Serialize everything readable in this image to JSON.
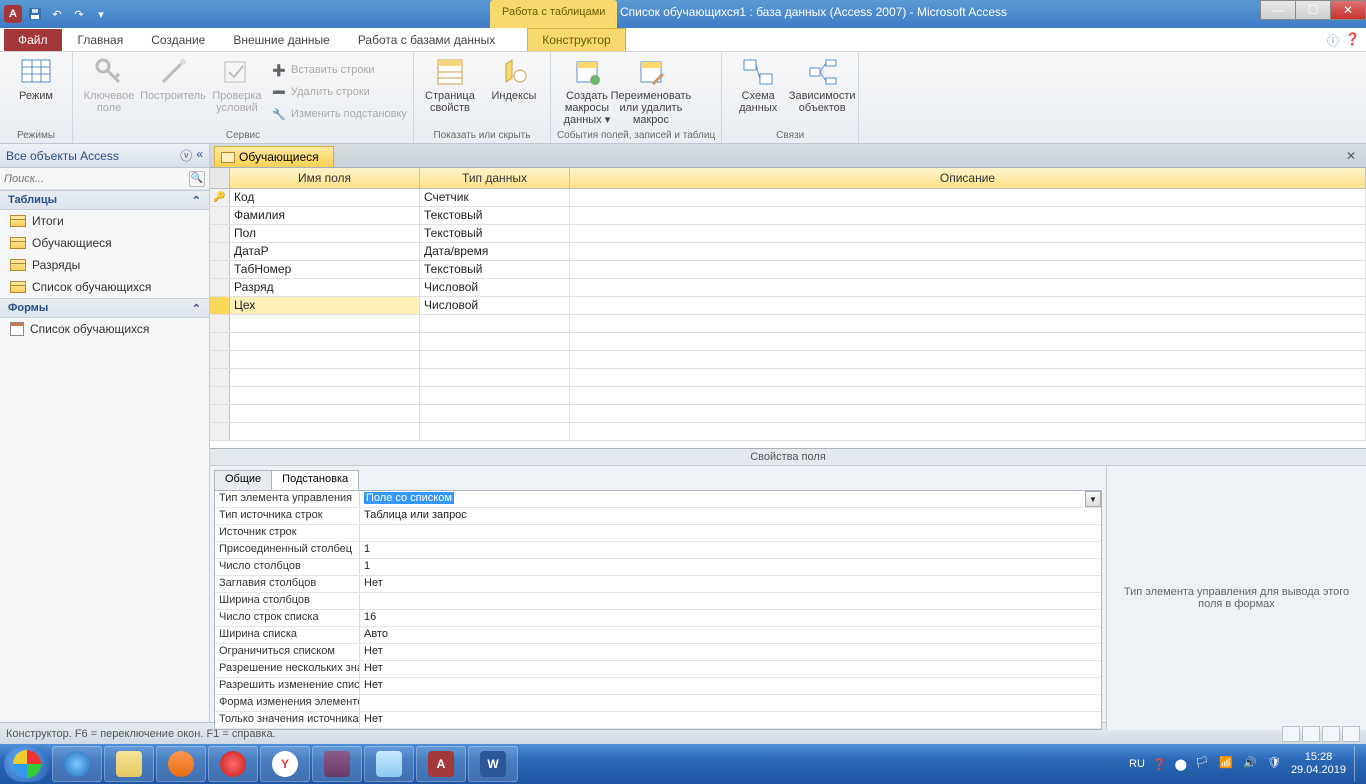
{
  "titlebar": {
    "contextual_tab": "Работа с таблицами",
    "title": "Список обучающихся1 : база данных (Access 2007)  -  Microsoft Access"
  },
  "ribbon_tabs": {
    "file": "Файл",
    "tabs": [
      "Главная",
      "Создание",
      "Внешние данные",
      "Работа с базами данных"
    ],
    "active": "Конструктор"
  },
  "ribbon": {
    "g1": {
      "label": "Режимы",
      "mode": "Режим"
    },
    "g2": {
      "label": "Сервис",
      "key": "Ключевое\nполе",
      "builder": "Построитель",
      "test": "Проверка\nусловий",
      "insert_rows": "Вставить строки",
      "delete_rows": "Удалить строки",
      "modify_lookup": "Изменить подстановку"
    },
    "g3": {
      "label": "Показать или скрыть",
      "propsheet": "Страница\nсвойств",
      "indexes": "Индексы"
    },
    "g4": {
      "label": "События полей, записей и таблиц",
      "create_macros": "Создать макросы\nданных ▾",
      "rename_delete": "Переименовать\nили удалить макрос"
    },
    "g5": {
      "label": "Связи",
      "relationships": "Схема\nданных",
      "dependencies": "Зависимости\nобъектов"
    }
  },
  "navpane": {
    "header": "Все объекты Access",
    "search_placeholder": "Поиск...",
    "groups": {
      "tables": {
        "label": "Таблицы",
        "items": [
          "Итоги",
          "Обучающиеся",
          "Разряды",
          "Список обучающихся"
        ]
      },
      "forms": {
        "label": "Формы",
        "items": [
          "Список обучающихся"
        ]
      }
    }
  },
  "document": {
    "tab": "Обучающиеся",
    "columns": {
      "name": "Имя поля",
      "type": "Тип данных",
      "desc": "Описание"
    },
    "fields": [
      {
        "name": "Код",
        "type": "Счетчик",
        "pk": true
      },
      {
        "name": "Фамилия",
        "type": "Текстовый"
      },
      {
        "name": "Пол",
        "type": "Текстовый"
      },
      {
        "name": "ДатаР",
        "type": "Дата/время"
      },
      {
        "name": "ТабНомер",
        "type": "Текстовый"
      },
      {
        "name": "Разряд",
        "type": "Числовой"
      },
      {
        "name": "Цех",
        "type": "Числовой",
        "selected": true
      }
    ]
  },
  "field_props": {
    "title": "Свойства поля",
    "tabs": {
      "general": "Общие",
      "lookup": "Подстановка"
    },
    "active_tab": "lookup",
    "rows": [
      {
        "label": "Тип элемента управления",
        "value": "Поле со списком",
        "active": true,
        "dropdown": true
      },
      {
        "label": "Тип источника строк",
        "value": "Таблица или запрос"
      },
      {
        "label": "Источник строк",
        "value": ""
      },
      {
        "label": "Присоединенный столбец",
        "value": "1"
      },
      {
        "label": "Число столбцов",
        "value": "1"
      },
      {
        "label": "Заглавия столбцов",
        "value": "Нет"
      },
      {
        "label": "Ширина столбцов",
        "value": ""
      },
      {
        "label": "Число строк списка",
        "value": "16"
      },
      {
        "label": "Ширина списка",
        "value": "Авто"
      },
      {
        "label": "Ограничиться списком",
        "value": "Нет"
      },
      {
        "label": "Разрешение нескольких значений",
        "value": "Нет"
      },
      {
        "label": "Разрешить изменение списка значений",
        "value": "Нет"
      },
      {
        "label": "Форма изменения элементов списка",
        "value": ""
      },
      {
        "label": "Только значения источника строк",
        "value": "Нет"
      }
    ],
    "help": "Тип элемента управления для вывода этого поля в формах"
  },
  "statusbar": {
    "text": "Конструктор.  F6 = переключение окон.  F1 = справка."
  },
  "taskbar": {
    "lang": "RU",
    "time": "15:28",
    "date": "29.04.2019"
  }
}
